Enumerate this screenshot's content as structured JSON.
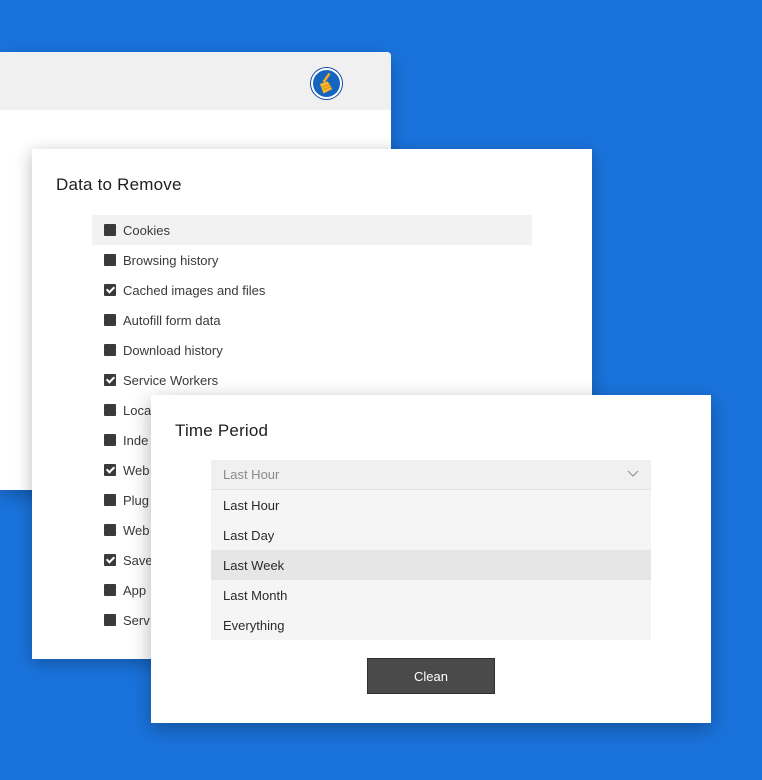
{
  "app": {
    "logo_icon": "broom-icon",
    "accent_color": "#1a73dc"
  },
  "data_panel": {
    "title": "Data to Remove",
    "items": [
      {
        "label": "Cookies",
        "checked": false,
        "hover": true
      },
      {
        "label": "Browsing history",
        "checked": false
      },
      {
        "label": "Cached images and files",
        "checked": true
      },
      {
        "label": "Autofill form data",
        "checked": false
      },
      {
        "label": "Download history",
        "checked": false
      },
      {
        "label": "Service Workers",
        "checked": true
      },
      {
        "label": "Loca",
        "checked": false
      },
      {
        "label": "Inde",
        "checked": false
      },
      {
        "label": "Web",
        "checked": true
      },
      {
        "label": "Plug",
        "checked": false
      },
      {
        "label": "Web",
        "checked": false
      },
      {
        "label": "Save",
        "checked": true
      },
      {
        "label": "App",
        "checked": false
      },
      {
        "label": "Serv",
        "checked": false
      }
    ]
  },
  "time_panel": {
    "title": "Time Period",
    "selected": "Last Hour",
    "options": [
      "Last Hour",
      "Last Day",
      "Last Week",
      "Last Month",
      "Everything"
    ],
    "hovered_option": "Last Week",
    "clean_label": "Clean"
  }
}
